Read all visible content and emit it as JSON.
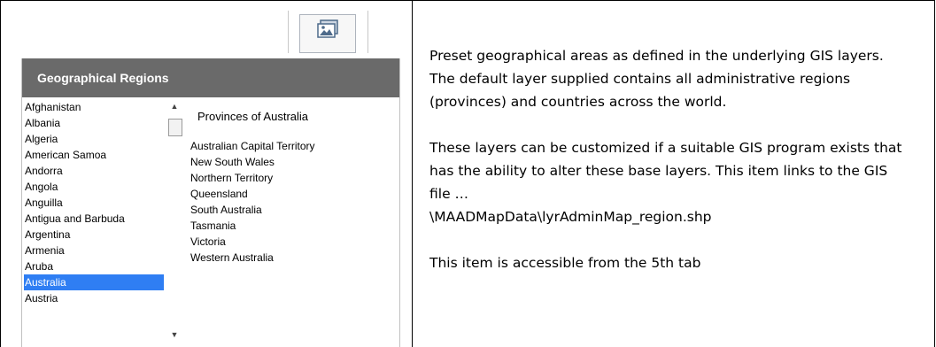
{
  "toolbar": {
    "image_button_icon": "image-icon"
  },
  "regions_panel": {
    "header": "Geographical Regions",
    "countries": [
      "Afghanistan",
      "Albania",
      "Algeria",
      "American Samoa",
      "Andorra",
      "Angola",
      "Anguilla",
      "Antigua and Barbuda",
      "Argentina",
      "Armenia",
      "Aruba",
      "Australia",
      "Austria"
    ],
    "selected_country": "Australia",
    "scroll_up": "▲",
    "scroll_down": "▼",
    "province_title": "Provinces of Australia",
    "provinces": [
      "Australian Capital Territory",
      "New South Wales",
      "Northern Territory",
      "Queensland",
      "South Australia",
      "Tasmania",
      "Victoria",
      "Western Australia"
    ]
  },
  "description": {
    "p1": "Preset geographical areas as defined in the underlying GIS layers. The default layer supplied contains all administrative regions (provinces) and countries across the world.",
    "p2_line1": "These layers can be customized if a suitable GIS program exists that has the ability to alter these base layers. This item links to the GIS file …",
    "p2_line2": "\\MAADMapData\\lyrAdminMap_region.shp",
    "p3": "This item is accessible from the 5th  tab"
  },
  "colors": {
    "header_bg": "#6a6a6a",
    "selection": "#2f7ef3"
  }
}
